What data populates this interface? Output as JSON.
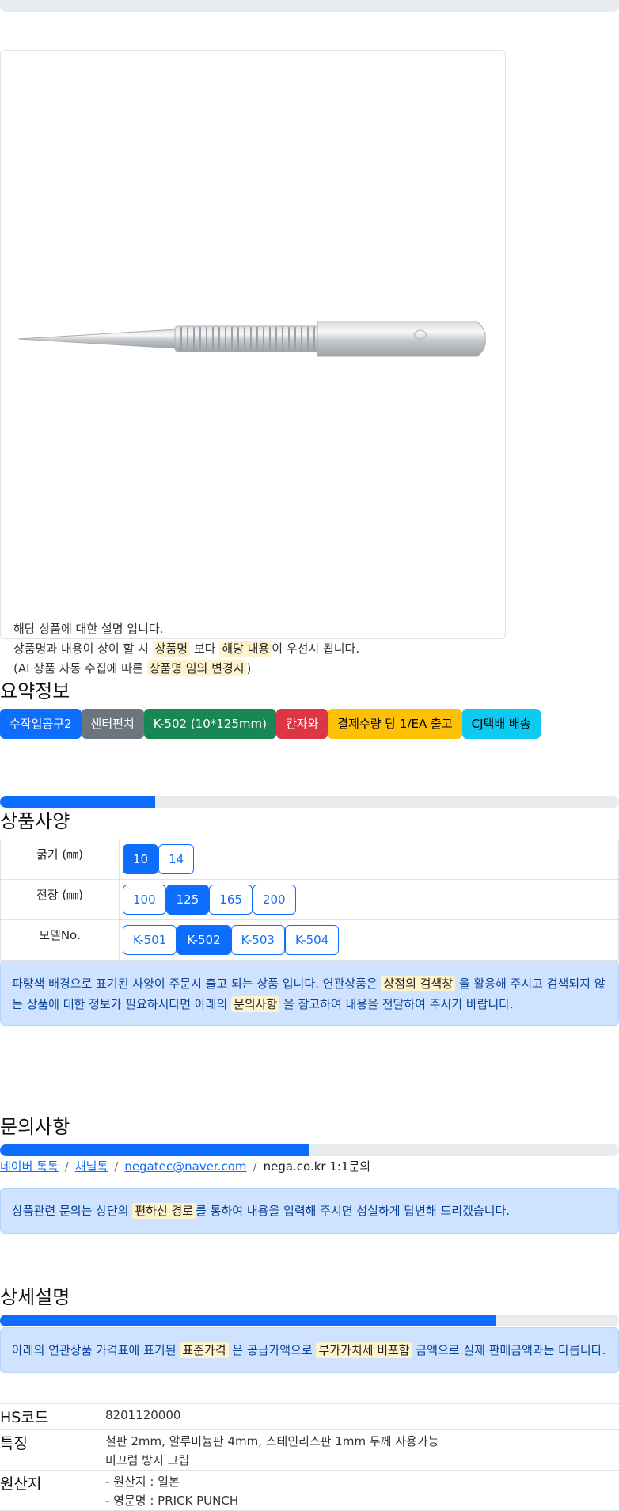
{
  "card": {
    "line1": "해당 상품에 대한 설명 입니다.",
    "line2_a": "상품명과 내용이 상이 할 시",
    "line2_hl1": "상품명",
    "line2_b": "보다",
    "line2_hl2": "해당 내용",
    "line2_c": "이 우선시 됩니다.",
    "line3_a": "(AI 상품 자동 수집에 따른",
    "line3_hl": "상품명 임의 변경시",
    "line3_b": ")"
  },
  "summary": {
    "title": "요약정보",
    "badges": [
      "수작업공구2",
      "센터펀치",
      "K-502 (10*125mm)",
      "칸자와",
      "결제수량 당 1/EA 출고",
      "CJ택배 배송"
    ]
  },
  "specs": {
    "title": "상품사양",
    "progress": 25,
    "rows": [
      {
        "label": "굵기 (㎜)",
        "options": [
          "10",
          "14"
        ],
        "selected": "10"
      },
      {
        "label": "전장 (㎜)",
        "options": [
          "100",
          "125",
          "165",
          "200"
        ],
        "selected": "125"
      },
      {
        "label": "모델No.",
        "options": [
          "K-501",
          "K-502",
          "K-503",
          "K-504"
        ],
        "selected": "K-502"
      }
    ],
    "notice": {
      "a": "파랑색 배경으로 표기된 사양이 주문시 출고 되는 상품 입니다. 연관상품은",
      "hl1": "상점의 검색창",
      "b": "을 활용해 주시고 검색되지 않",
      "c": "는 상품에 대한 정보가 필요하시다면 아래의",
      "hl2": "문의사항",
      "d": "을 참고하여 내용을 전달하여 주시기 바랍니다."
    }
  },
  "inquiry": {
    "title": "문의사항",
    "progress": 50,
    "links": [
      "네이버 톡톡",
      "채널톡",
      "negatec@naver.com"
    ],
    "plain": "nega.co.kr 1:1문의",
    "separator": "/",
    "notice": {
      "a": "상품관련 문의는 상단의",
      "hl": "편하신 경로",
      "b": "를 통하여 내용을 입력해 주시면 성실하게 답변해 드리겠습니다."
    }
  },
  "detail": {
    "title": "상세설명",
    "progress": 80,
    "notice": {
      "a": "아래의 연관상품 가격표에 표기된",
      "hl1": "표준가격",
      "b": "은 공급가액으로",
      "hl2": "부가가치세 비포함",
      "c": "금액으로 실제 판매금액과는 다릅니다."
    },
    "rows": [
      {
        "key": "HS코드",
        "lines": [
          "8201120000"
        ]
      },
      {
        "key": "특징",
        "lines": [
          "철판 2mm, 알루미늄판 4mm, 스테인리스판 1mm 두께 사용가능",
          "미끄럼 방지 그립"
        ]
      },
      {
        "key": "원산지",
        "lines": [
          "- 원산지 : 일본",
          "- 영문명 : PRICK PUNCH"
        ]
      }
    ]
  },
  "colors": {
    "primary": "#0d6efd",
    "secondary": "#6c757d",
    "success": "#198754",
    "danger": "#dc3545",
    "warning": "#ffc107",
    "info": "#0dcaf0",
    "highlight": "#fff3cd",
    "alert_bg": "#cfe2ff"
  }
}
